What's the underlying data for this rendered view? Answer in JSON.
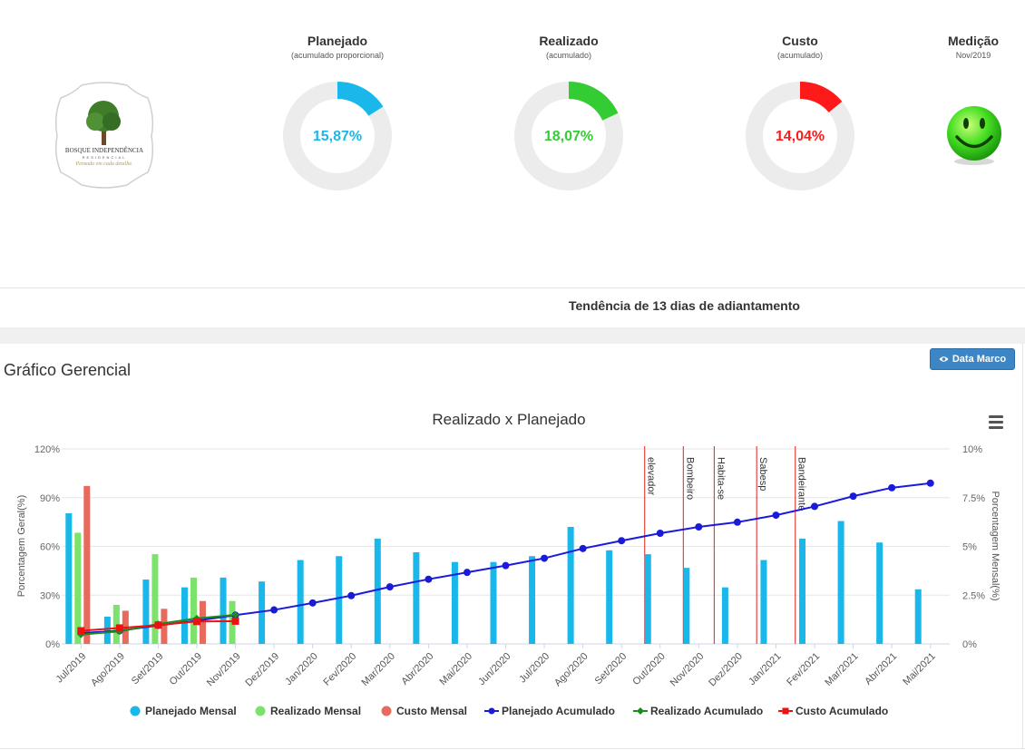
{
  "kpis": [
    {
      "title": "Planejado",
      "subtitle": "(acumulado proporcional)",
      "value": "15,87%",
      "fraction": 0.1587,
      "color": "#1ab7ea"
    },
    {
      "title": "Realizado",
      "subtitle": "(acumulado)",
      "value": "18,07%",
      "fraction": 0.1807,
      "color": "#33cc33"
    },
    {
      "title": "Custo",
      "subtitle": "(acumulado)",
      "value": "14,04%",
      "fraction": 0.1404,
      "color": "#ff1a1a"
    }
  ],
  "medicao": {
    "title": "Medição",
    "subtitle": "Nov/2019",
    "icon": "smiley-face-icon"
  },
  "logo": {
    "name": "BOSQUE INDEPENDÊNCIA",
    "tagline": "RESIDENCIAL",
    "slogan": "Pensado em cada detalhe."
  },
  "trend_text": "Tendência de 13 dias de adiantamento",
  "panel": {
    "title": "Gráfico Gerencial",
    "button_label": "Data Marco",
    "button_icon": "eye-icon"
  },
  "chart_data": {
    "type": "bar",
    "title": "Realizado x Planejado",
    "ylabel_left": "Porcentagem Geral(%)",
    "ylabel_right": "Porcentagem Mensal(%)",
    "ylim_left": [
      0,
      120
    ],
    "ylim_right": [
      0,
      10
    ],
    "yticks_left": [
      "0%",
      "30%",
      "60%",
      "90%",
      "120%"
    ],
    "yticks_right": [
      "0%",
      "2.5%",
      "5%",
      "7.5%",
      "10%"
    ],
    "grid": true,
    "legend_position": "bottom",
    "categories": [
      "Jul/2019",
      "Ago/2019",
      "Set/2019",
      "Out/2019",
      "Nov/2019",
      "Dez/2019",
      "Jan/2020",
      "Fev/2020",
      "Mar/2020",
      "Abr/2020",
      "Mai/2020",
      "Jun/2020",
      "Jul/2020",
      "Ago/2020",
      "Set/2020",
      "Out/2020",
      "Nov/2020",
      "Dez/2020",
      "Jan/2021",
      "Fev/2021",
      "Mar/2021",
      "Abr/2021",
      "Mai/2021"
    ],
    "series": [
      {
        "name": "Planejado Mensal",
        "kind": "bar",
        "axis": "right",
        "color": "#1ab7ea",
        "values": [
          6.7,
          1.4,
          3.3,
          2.9,
          3.4,
          3.2,
          4.3,
          4.5,
          5.4,
          4.7,
          4.2,
          4.2,
          4.5,
          6.0,
          4.8,
          4.6,
          3.9,
          2.9,
          4.3,
          5.4,
          6.3,
          5.2,
          2.8
        ]
      },
      {
        "name": "Realizado Mensal",
        "kind": "bar",
        "axis": "right",
        "color": "#7be36b",
        "values": [
          5.7,
          2.0,
          4.6,
          3.4,
          2.2
        ]
      },
      {
        "name": "Custo Mensal",
        "kind": "bar",
        "axis": "right",
        "color": "#e86a5c",
        "values": [
          8.1,
          1.7,
          1.8,
          2.2
        ]
      },
      {
        "name": "Planejado Acumulado",
        "kind": "line",
        "axis": "left",
        "color": "#1a1adb",
        "marker": "circle",
        "values": [
          6.7,
          8.1,
          11.4,
          14.3,
          17.7,
          20.9,
          25.2,
          29.7,
          35.1,
          39.8,
          44.0,
          48.2,
          52.7,
          58.7,
          63.5,
          68.1,
          72.0,
          74.9,
          79.2,
          84.6,
          90.9,
          96.1,
          98.9
        ]
      },
      {
        "name": "Realizado Acumulado",
        "kind": "line",
        "axis": "left",
        "color": "#1e8b1e",
        "marker": "diamond",
        "values": [
          5.7,
          7.7,
          12.3,
          15.7,
          17.9
        ]
      },
      {
        "name": "Custo Acumulado",
        "kind": "line",
        "axis": "left",
        "color": "#ee1111",
        "marker": "square",
        "values": [
          8.1,
          9.8,
          11.6,
          13.8,
          14.0
        ]
      }
    ],
    "milestones": [
      {
        "label": "elevador",
        "position": 15.1
      },
      {
        "label": "Bombeiro",
        "position": 16.1
      },
      {
        "label": "Habita-se",
        "position": 16.9
      },
      {
        "label": "Sabesp",
        "position": 18.0
      },
      {
        "label": "Bandeirante",
        "position": 19.0
      }
    ]
  }
}
